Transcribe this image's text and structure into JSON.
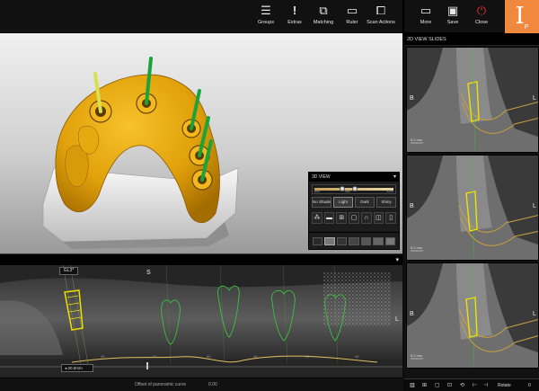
{
  "toolbar": {
    "groups": "Groups",
    "extras": "Extras",
    "matching": "Matching",
    "ruler": "Ruler",
    "scan_actions": "Scan Actions",
    "more": "More",
    "save": "Save",
    "close": "Close"
  },
  "logo": {
    "main": "I",
    "sub": "P"
  },
  "panel3d": {
    "title": "3D VIEW",
    "slider": {
      "left": "850",
      "mid": "960",
      "right": "3250"
    },
    "shades": [
      "No Shade",
      "Light",
      "Dark",
      "Shiny"
    ],
    "active_shade": "Light"
  },
  "panoramic": {
    "label_s": "S",
    "label_l": "L",
    "tooth_tag": "GL3*",
    "scale": "20.0mm",
    "offset_label": "Offset of panoramic curve",
    "offset_value": "0.00",
    "ruler_marks": [
      "40",
      "60",
      "80",
      "40",
      "20",
      "40",
      "60"
    ]
  },
  "right_panel": {
    "title": "2D VIEW SLIDES",
    "slices": [
      {
        "left": "B",
        "right": "L",
        "scale": "5.0 mm"
      },
      {
        "left": "B",
        "right": "L",
        "scale": "5.0 mm"
      },
      {
        "left": "B",
        "right": "L",
        "scale": "5.0 mm"
      }
    ],
    "footer_rotate": "Rotate",
    "footer_value": "0"
  },
  "colors": {
    "accent": "#f0883e",
    "model": "#e8a90c",
    "implant": "#1aa33a"
  }
}
